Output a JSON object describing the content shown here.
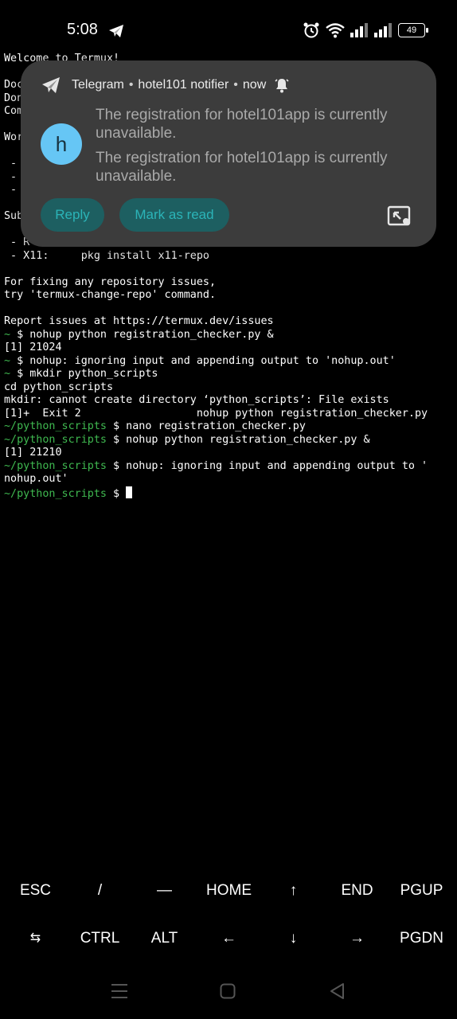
{
  "status_bar": {
    "time": "5:08",
    "battery": "49",
    "icons": [
      "telegram-icon",
      "alarm-icon",
      "wifi-icon",
      "signal-icon",
      "signal-icon",
      "battery-icon"
    ]
  },
  "terminal": {
    "lines": [
      {
        "text": "Welcome to Termux!"
      },
      {
        "text": ""
      },
      {
        "text": "Doc"
      },
      {
        "text": "Don"
      },
      {
        "text": "Com"
      },
      {
        "text": ""
      },
      {
        "text": "Wor"
      },
      {
        "text": ""
      },
      {
        "text": " -"
      },
      {
        "text": " -"
      },
      {
        "text": " -"
      },
      {
        "text": ""
      },
      {
        "text": "Sub"
      },
      {
        "text": ""
      },
      {
        "text": " - R"
      },
      {
        "text": " - X11:     pkg install x11-repo"
      },
      {
        "text": ""
      },
      {
        "text": "For fixing any repository issues,"
      },
      {
        "text": "try 'termux-change-repo' command."
      },
      {
        "text": ""
      },
      {
        "text": "Report issues at https://termux.dev/issues"
      },
      {
        "prompt": "~",
        "text": " $ nohup python registration_checker.py &"
      },
      {
        "text": "[1] 21024"
      },
      {
        "prompt": "~",
        "text": " $ nohup: ignoring input and appending output to 'nohup.out'"
      },
      {
        "prompt": "~",
        "text": " $ mkdir python_scripts"
      },
      {
        "text": "cd python_scripts"
      },
      {
        "text": "mkdir: cannot create directory ‘python_scripts’: File exists"
      },
      {
        "text": "[1]+  Exit 2                  nohup python registration_checker.py"
      },
      {
        "prompt": "~/python_scripts",
        "text": " $ nano registration_checker.py"
      },
      {
        "prompt": "~/python_scripts",
        "text": " $ nohup python registration_checker.py &"
      },
      {
        "text": "[1] 21210"
      },
      {
        "prompt": "~/python_scripts",
        "text": " $ nohup: ignoring input and appending output to '"
      },
      {
        "text": "nohup.out'"
      },
      {
        "prompt": "~/python_scripts",
        "text": " $ ",
        "cursor": true
      }
    ]
  },
  "notification": {
    "app": "Telegram",
    "source": "hotel101 notifier",
    "time": "now",
    "avatar_letter": "h",
    "messages": [
      "The registration for hotel101app is currently unavailable.",
      "The registration for hotel101app is currently unavailable."
    ],
    "actions": {
      "reply": "Reply",
      "mark_read": "Mark as read"
    },
    "colors": {
      "avatar": "#66c6f5",
      "action_bg": "#1d5f61",
      "action_text": "#2bb4b8"
    }
  },
  "extra_keys": {
    "row1": [
      "ESC",
      "/",
      "—",
      "HOME",
      "↑",
      "END",
      "PGUP"
    ],
    "row2": [
      "⇆",
      "CTRL",
      "ALT",
      "←",
      "↓",
      "→",
      "PGDN"
    ]
  },
  "colors": {
    "prompt": "#3fb950",
    "background": "#000000"
  }
}
